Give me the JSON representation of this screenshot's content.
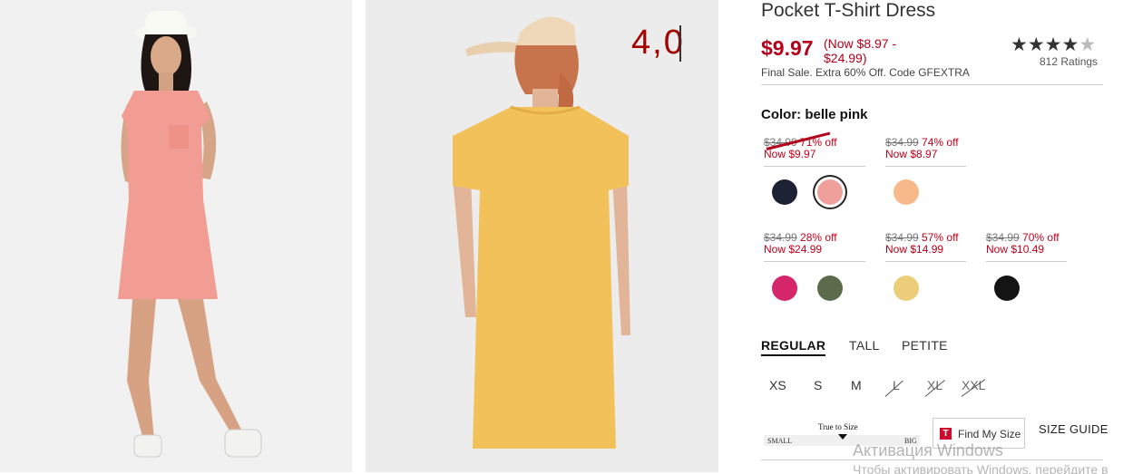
{
  "overlay_text": "4,0",
  "product": {
    "title": "Pocket T-Shirt Dress",
    "price": "$9.97",
    "price_range": "(Now $8.97 - $24.99)",
    "final_sale": "Final Sale. Extra 60% Off. Code GFEXTRA",
    "rating_stars": "★★★★",
    "rating_half_star": "★",
    "rating_count": "812 Ratings"
  },
  "color": {
    "label": "Color: belle pink",
    "groups": [
      {
        "old": "$34.99",
        "off": "71% off",
        "now": "Now $9.97"
      },
      {
        "old": "$34.99",
        "off": "74% off",
        "now": "Now $8.97"
      },
      {
        "old": "$34.99",
        "off": "28% off",
        "now": "Now $24.99"
      },
      {
        "old": "$34.99",
        "off": "57% off",
        "now": "Now $14.99"
      },
      {
        "old": "$34.99",
        "off": "70% off",
        "now": "Now $10.49"
      }
    ],
    "swatches": {
      "navy": "#1c2134",
      "belle_pink": "#f0a09a",
      "peach": "#f8b98a",
      "magenta": "#d6266a",
      "olive": "#5c6b4c",
      "yellow": "#ecce7a",
      "black": "#141414"
    }
  },
  "fit": {
    "tabs": [
      "REGULAR",
      "TALL",
      "PETITE"
    ]
  },
  "sizes": [
    "XS",
    "S",
    "M",
    "L",
    "XL",
    "XXL"
  ],
  "true_to_size": {
    "label": "True to Size",
    "small": "SMALL",
    "big": "BIG"
  },
  "find_my_size": {
    "icon_letter": "T",
    "label": "Find My Size"
  },
  "size_guide": "SIZE GUIDE",
  "windows_activation": {
    "line1": "Активация Windows",
    "line2": "Чтобы активировать Windows, перейдите в"
  }
}
